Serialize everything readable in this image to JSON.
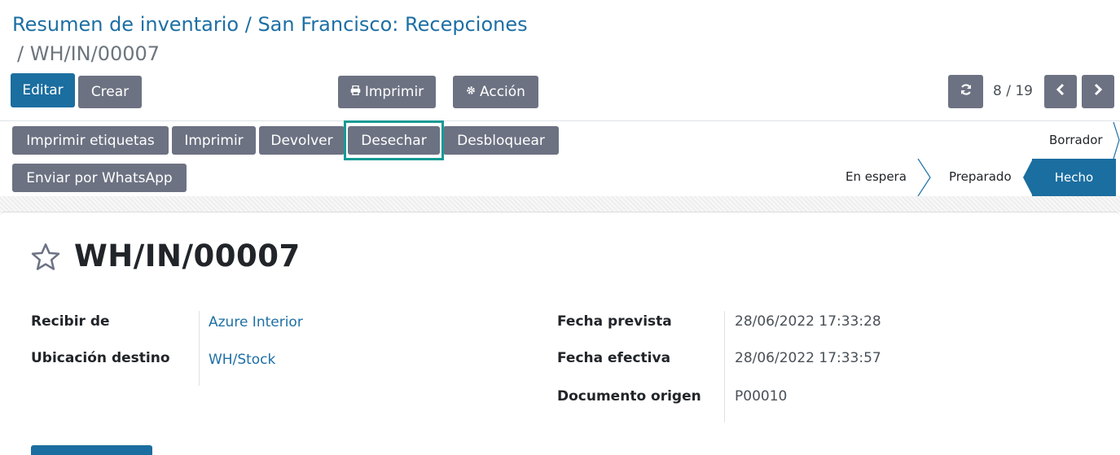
{
  "breadcrumb": {
    "part1": "Resumen de inventario",
    "sep1": " / ",
    "part2": "San Francisco: Recepciones",
    "sep2": "/ ",
    "current": "WH/IN/00007"
  },
  "control_panel": {
    "edit_label": "Editar",
    "create_label": "Crear",
    "print_label": "Imprimir",
    "action_label": "Acción",
    "pager_value": "8 / 19",
    "icons": {
      "print": "print-icon",
      "action": "gear-icon",
      "refresh": "refresh-icon",
      "prev": "chevron-left-icon",
      "next": "chevron-right-icon"
    }
  },
  "header_buttons": [
    "Imprimir etiquetas",
    "Imprimir",
    "Devolver",
    "Desechar",
    "Desbloquear",
    "Enviar por WhatsApp"
  ],
  "statusbar": {
    "items": [
      "Borrador",
      "En espera",
      "Preparado",
      "Hecho"
    ],
    "active": "Hecho"
  },
  "record": {
    "title": "WH/IN/00007",
    "fields_left": [
      {
        "label": "Recibir de",
        "value": "Azure Interior"
      },
      {
        "label": "Ubicación destino",
        "value": "WH/Stock"
      }
    ],
    "fields_right": [
      {
        "label": "Fecha prevista",
        "value": "28/06/2022 17:33:28"
      },
      {
        "label": "Fecha efectiva",
        "value": "28/06/2022 17:33:57"
      },
      {
        "label": "Documento origen",
        "value": "P00010"
      }
    ]
  },
  "colors": {
    "primary": "#1b6ea0",
    "secondary": "#6c7282",
    "link": "#1d6fa5",
    "highlight": "#159a94"
  }
}
